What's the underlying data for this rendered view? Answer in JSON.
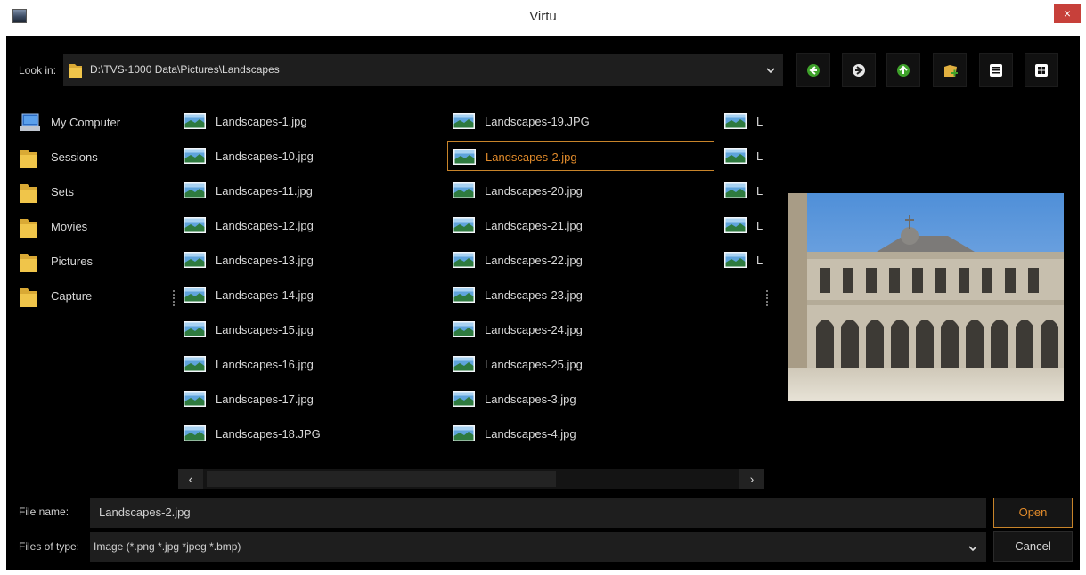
{
  "window": {
    "title": "Virtu",
    "close_symbol": "×"
  },
  "lookin": {
    "label": "Look in:",
    "path": "D:\\TVS-1000 Data\\Pictures\\Landscapes"
  },
  "toolbar": [
    {
      "name": "back-button",
      "icon": "back-arrow-icon"
    },
    {
      "name": "forward-button",
      "icon": "forward-arrow-icon"
    },
    {
      "name": "up-folder-button",
      "icon": "up-arrow-icon"
    },
    {
      "name": "new-folder-button",
      "icon": "new-folder-icon"
    },
    {
      "name": "list-view-button",
      "icon": "list-view-icon"
    },
    {
      "name": "detail-view-button",
      "icon": "grid-view-icon"
    }
  ],
  "sidebar": {
    "items": [
      {
        "label": "My Computer",
        "icon": "computer-icon"
      },
      {
        "label": "Sessions",
        "icon": "folder-icon"
      },
      {
        "label": "Sets",
        "icon": "folder-icon"
      },
      {
        "label": "Movies",
        "icon": "folder-icon"
      },
      {
        "label": "Pictures",
        "icon": "folder-icon"
      },
      {
        "label": "Capture",
        "icon": "folder-icon"
      }
    ]
  },
  "files": {
    "column1": [
      "Landscapes-1.jpg",
      "Landscapes-10.jpg",
      "Landscapes-11.jpg",
      "Landscapes-12.jpg",
      "Landscapes-13.jpg",
      "Landscapes-14.jpg",
      "Landscapes-15.jpg",
      "Landscapes-16.jpg",
      "Landscapes-17.jpg",
      "Landscapes-18.JPG"
    ],
    "column2": [
      "Landscapes-19.JPG",
      "Landscapes-2.jpg",
      "Landscapes-20.jpg",
      "Landscapes-21.jpg",
      "Landscapes-22.jpg",
      "Landscapes-23.jpg",
      "Landscapes-24.jpg",
      "Landscapes-25.jpg",
      "Landscapes-3.jpg",
      "Landscapes-4.jpg"
    ],
    "column3": [
      "L",
      "L",
      "L",
      "L",
      "L"
    ],
    "selected": "Landscapes-2.jpg"
  },
  "scroll": {
    "left_arrow": "‹",
    "right_arrow": "›"
  },
  "filename": {
    "label": "File name:",
    "value": "Landscapes-2.jpg"
  },
  "filetype": {
    "label": "Files of type:",
    "value": "Image (*.png *.jpg *jpeg *.bmp)"
  },
  "buttons": {
    "open": "Open",
    "cancel": "Cancel"
  },
  "colors": {
    "accent": "#c8842a",
    "background": "#000000",
    "close": "#c7403a"
  }
}
